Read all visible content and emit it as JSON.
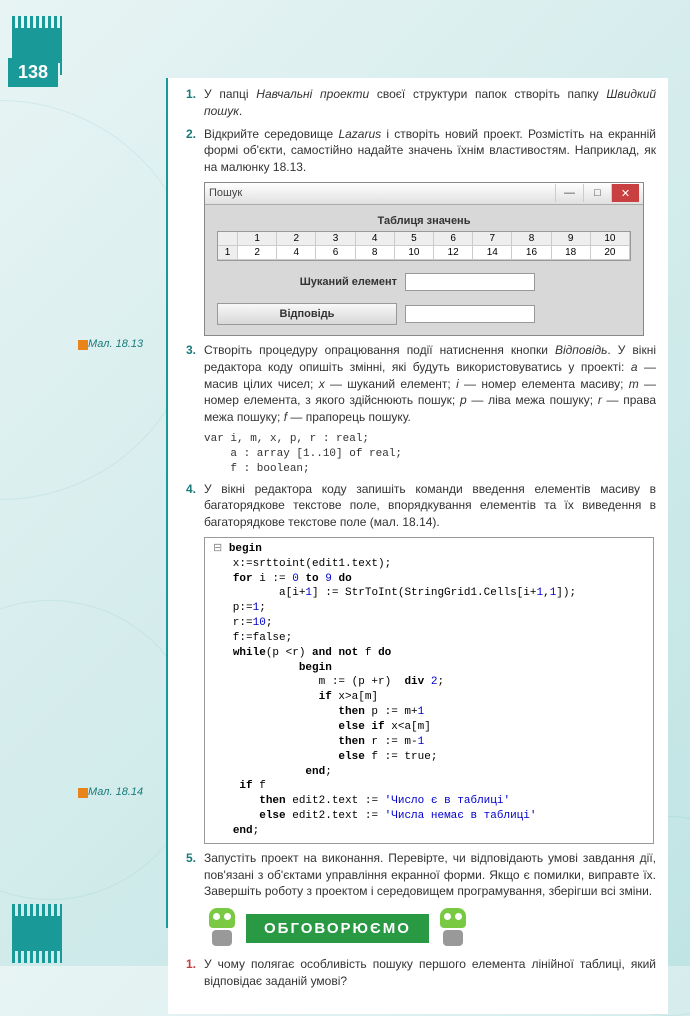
{
  "page_number": "138",
  "fig1_label": "Мал. 18.13",
  "fig2_label": "Мал. 18.14",
  "items": {
    "i1": {
      "num": "1.",
      "text_a": "У папці ",
      "text_b": "Навчальні проекти",
      "text_c": " своєї структури папок створіть папку ",
      "text_d": "Швидкий пошук",
      "text_e": "."
    },
    "i2": {
      "num": "2.",
      "text_a": "Відкрийте середовище ",
      "text_b": "Lazarus",
      "text_c": " і створіть новий проект. Розмістіть на екранній формі об'єкти, самостійно надайте значень їхнім властивостям. Наприклад, як на малюнку 18.13."
    },
    "i3": {
      "num": "3.",
      "text_a": "Створіть процедуру опрацювання події натиснення кнопки ",
      "text_b": "Відповідь",
      "text_c": ". У вікні редактора коду опишіть змінні, які будуть використовуватись у проекті: ",
      "text_d": "a",
      "text_e": " — масив цілих чисел; ",
      "text_f": "x",
      "text_g": " — шуканий елемент; ",
      "text_h": "i",
      "text_i": " — номер елемента масиву; ",
      "text_j": "m",
      "text_k": " — номер елемента, з якого здійснюють пошук; ",
      "text_l": "p",
      "text_m": " — ліва межа пошуку; ",
      "text_n": "r",
      "text_o": " — права межа пошуку; ",
      "text_p": "f",
      "text_q": " — прапорець пошуку."
    },
    "i4": {
      "num": "4.",
      "text": "У вікні редактора коду запишіть команди введення елементів масиву в багаторядкове текстове поле, впорядкування елементів та їх виведення в багаторядкове текстове поле (мал. 18.14)."
    },
    "i5": {
      "num": "5.",
      "text": "Запустіть проект на виконання. Перевірте, чи відповідають умові завдання дії, пов'язані з об'єктами управління екранної форми. Якщо є помилки, виправте їх. Завершіть роботу з проектом і середовищем програмування, зберігши всі зміни."
    }
  },
  "window": {
    "title": "Пошук",
    "tab_label": "Таблиця значень",
    "headers": [
      "1",
      "2",
      "3",
      "4",
      "5",
      "6",
      "7",
      "8",
      "9",
      "10"
    ],
    "row": [
      "2",
      "4",
      "6",
      "8",
      "10",
      "12",
      "14",
      "16",
      "18",
      "20"
    ],
    "search_label": "Шуканий елемент",
    "answer_btn": "Відповідь"
  },
  "code1": "var i, m, x, p, r : real;\n    a : array [1..10] of real;\n    f : boolean;",
  "banner_text": "ОБГОВОРЮЄМО",
  "question": {
    "num": "1.",
    "text": "У чому полягає особливість пошуку першого елемента лінійної таблиці, який відповідає заданій умові?"
  }
}
